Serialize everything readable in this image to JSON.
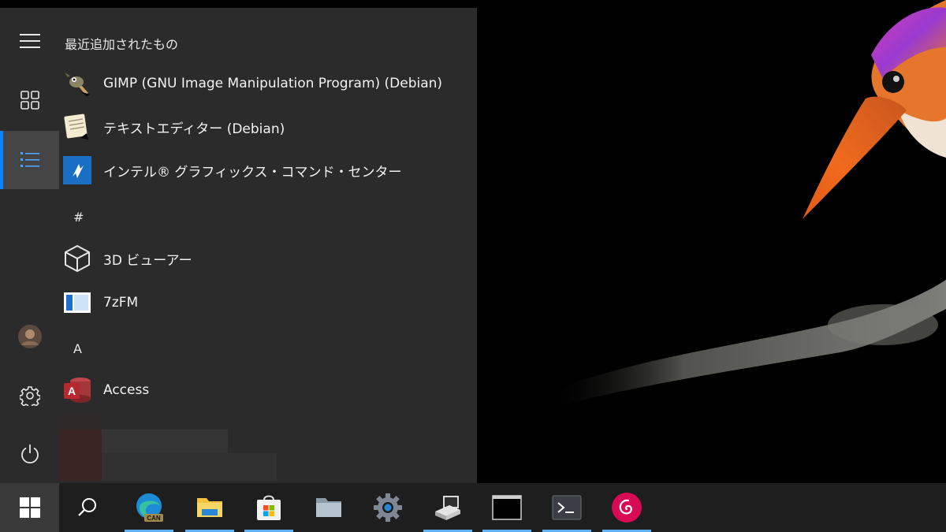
{
  "start_menu": {
    "recent_title": "最近追加されたもの",
    "recent_apps": [
      {
        "label": "GIMP (GNU Image Manipulation Program) (Debian)",
        "icon": "gimp-icon"
      },
      {
        "label": "テキストエディター (Debian)",
        "icon": "text-editor-icon"
      },
      {
        "label": "インテル® グラフィックス・コマンド・センター",
        "icon": "intel-graphics-icon"
      }
    ],
    "group_hash": "#",
    "hash_apps": [
      {
        "label": "3D ビューアー",
        "icon": "3d-viewer-icon"
      },
      {
        "label": "7zFM",
        "icon": "7zfm-icon"
      }
    ],
    "group_a": "A",
    "a_apps": [
      {
        "label": "Access",
        "icon": "access-icon",
        "icon_letter": "A"
      }
    ]
  },
  "rail": {
    "items": [
      "menu-icon",
      "tiles-icon",
      "list-icon",
      "avatar",
      "gear-icon",
      "power-icon"
    ]
  },
  "taskbar": {
    "items": [
      "windows-start-icon",
      "search-icon",
      "edge-icon",
      "file-explorer-icon",
      "store-icon",
      "folder-icon",
      "settings-icon",
      "device-manager-icon",
      "command-prompt-icon",
      "terminal-icon",
      "debian-icon"
    ],
    "edge_badge": "CAN"
  },
  "colors": {
    "accent": "#0a84ff",
    "taskbar_underline": "#5fb2f2",
    "access_red": "#a4373a",
    "debian_red": "#d70a53"
  }
}
